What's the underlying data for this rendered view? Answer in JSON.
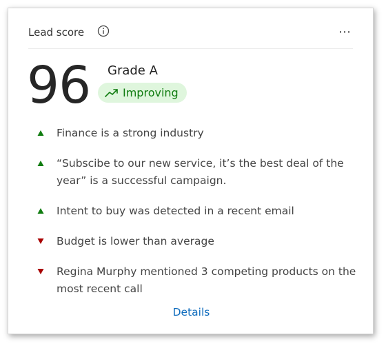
{
  "card": {
    "title": "Lead score",
    "score": "96",
    "grade": "Grade A",
    "trend_label": "Improving",
    "details_link": "Details",
    "colors": {
      "positive": "#107c10",
      "negative": "#a80000",
      "pill_bg": "#dff6dd",
      "link": "#0f6cbd"
    },
    "factors": [
      {
        "direction": "up",
        "text": "Finance is a strong industry"
      },
      {
        "direction": "up",
        "text": "“Subscibe to our new service, it’s the best deal of the year” is a successful campaign."
      },
      {
        "direction": "up",
        "text": "Intent to buy was detected in a recent email"
      },
      {
        "direction": "down",
        "text": "Budget is lower than average"
      },
      {
        "direction": "down",
        "text": "Regina Murphy mentioned 3 competing products on the most recent call"
      }
    ],
    "icons": {
      "info": "info-icon",
      "more": "more-options-icon",
      "trend": "trending-up-icon"
    }
  }
}
